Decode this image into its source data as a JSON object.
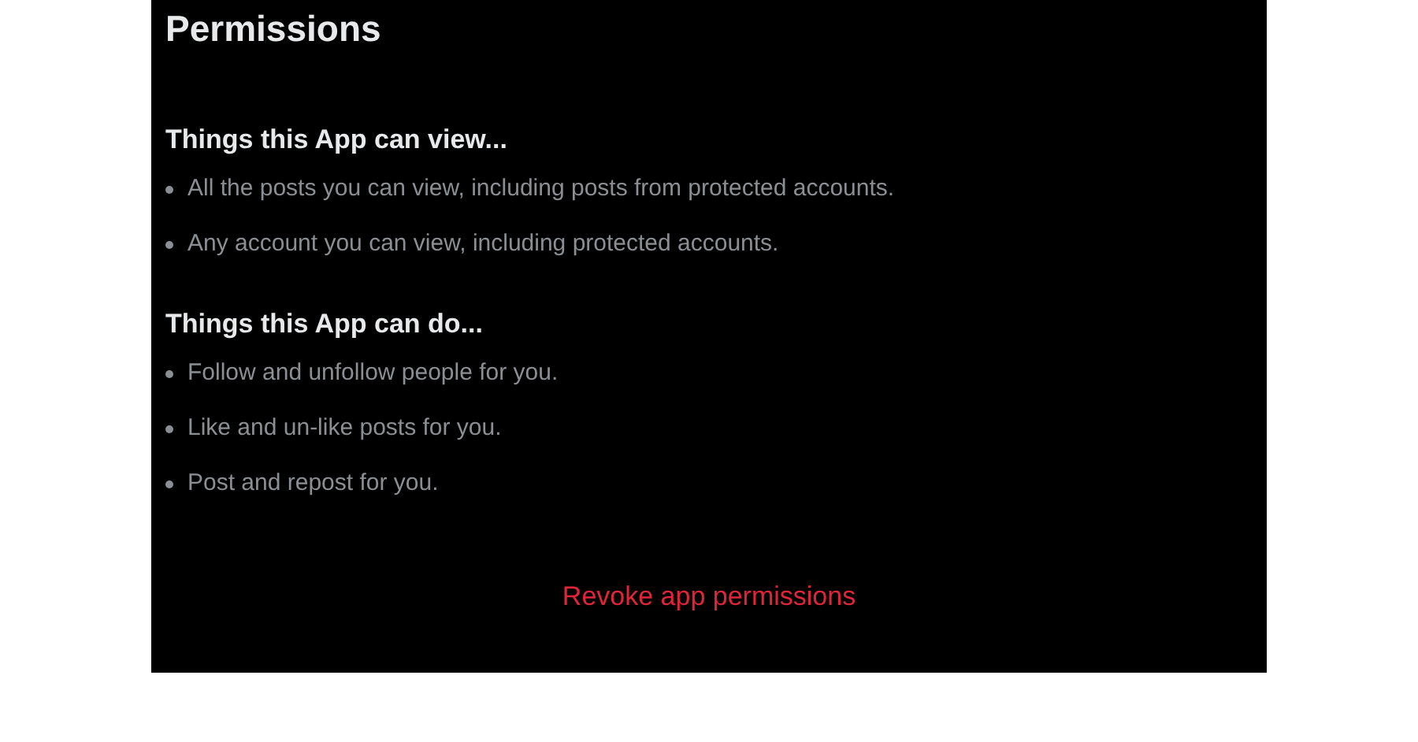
{
  "title": "Permissions",
  "sections": [
    {
      "heading": "Things this App can view...",
      "items": [
        "All the posts you can view, including posts from protected accounts.",
        "Any account you can view, including protected accounts."
      ]
    },
    {
      "heading": "Things this App can do...",
      "items": [
        "Follow and unfollow people for you.",
        "Like and un-like posts for you.",
        "Post and repost for you."
      ]
    }
  ],
  "revoke_link": "Revoke app permissions"
}
